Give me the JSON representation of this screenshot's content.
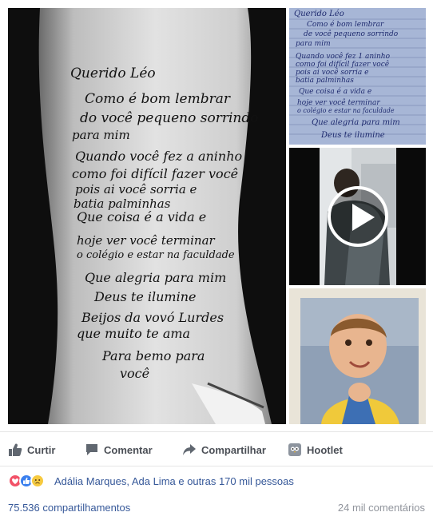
{
  "tattoo_text": [
    "Querido Léo",
    "Como é bom lembrar",
    "do você pequeno sorrindo",
    "para mim",
    "Quando você fez a aninho",
    "como foi difícil fazer você",
    "pois ai você sorria e",
    "batia palminhas",
    "Que coisa é a vida e",
    "hoje ver você terminar",
    "o colégio e estar na faculdade",
    "Que alegria para mim",
    "Deus te ilumine",
    "Beijos da vovó Lurdes",
    "que muito te ama",
    "Para bemo para",
    "você"
  ],
  "letter_text": [
    "Querido Léo",
    "Como é bom lembrar",
    "de você pequeno sorrindo",
    "para mim",
    "Quando você fez 1 aninho",
    "como foi difícil fazer você",
    "pois ai você sorria e",
    "batia palminhas",
    "Que coisa é a vida e",
    "hoje ver você terminar",
    "o colégio e estar na faculdade",
    "Que alegria para mim",
    "Deus te ilumine"
  ],
  "actions": {
    "like": "Curtir",
    "comment": "Comentar",
    "share": "Compartilhar",
    "hootlet": "Hootlet"
  },
  "reactions": {
    "text": "Adália Marques, Ada Lima e outras 170 mil pessoas",
    "icons": [
      "love-icon",
      "like-icon",
      "sad-icon"
    ]
  },
  "stats": {
    "shares": "75.536 compartilhamentos",
    "comments": "24 mil comentários"
  },
  "colors": {
    "link": "#365899",
    "action_text": "#4b4f56",
    "love": "#f25268",
    "like": "#3b80ee",
    "sad": "#f7ca3f"
  }
}
